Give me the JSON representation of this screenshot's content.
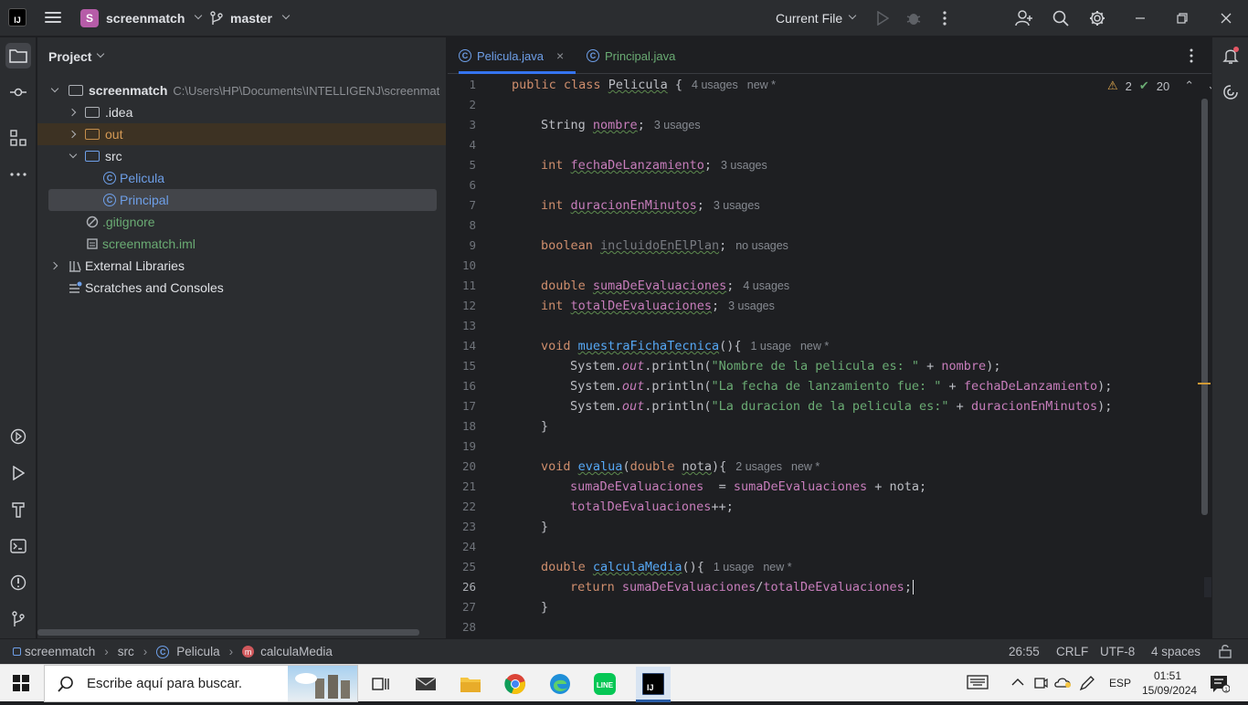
{
  "titlebar": {
    "logo_text": "IJ",
    "project_badge": "S",
    "project_name": "screenmatch",
    "branch": "master",
    "run_config": "Current File"
  },
  "project_panel": {
    "title": "Project",
    "tree": [
      {
        "label": "screenmatch",
        "path": "C:\\Users\\HP\\Documents\\INTELLIGENJ\\screenmat"
      },
      {
        "label": ".idea"
      },
      {
        "label": "out"
      },
      {
        "label": "src"
      },
      {
        "label": "Pelicula"
      },
      {
        "label": "Principal"
      },
      {
        "label": ".gitignore"
      },
      {
        "label": "screenmatch.iml"
      },
      {
        "label": "External Libraries"
      },
      {
        "label": "Scratches and Consoles"
      }
    ]
  },
  "tabs": [
    {
      "label": "Pelicula.java",
      "active": true
    },
    {
      "label": "Principal.java",
      "active": false
    }
  ],
  "inspection": {
    "warnings": "2",
    "ok": "20"
  },
  "line_numbers": [
    "1",
    "2",
    "3",
    "4",
    "5",
    "6",
    "7",
    "8",
    "9",
    "10",
    "11",
    "12",
    "13",
    "14",
    "15",
    "16",
    "17",
    "18",
    "19",
    "20",
    "21",
    "22",
    "23",
    "24",
    "25",
    "26",
    "27",
    "28"
  ],
  "code": {
    "l1": {
      "kw1": "public",
      "kw2": "class",
      "name": "Pelicula",
      "brace": "{",
      "hint": "4 usages",
      "hint2": "new *"
    },
    "l3": {
      "type": "String",
      "name": "nombre",
      "semi": ";",
      "hint": "3 usages"
    },
    "l5": {
      "type": "int",
      "name": "fechaDeLanzamiento",
      "semi": ";",
      "hint": "3 usages"
    },
    "l7": {
      "type": "int",
      "name": "duracionEnMinutos",
      "semi": ";",
      "hint": "3 usages"
    },
    "l9": {
      "type": "boolean",
      "name": "incluidoEnElPlan",
      "semi": ";",
      "hint": "no usages"
    },
    "l11": {
      "type": "double",
      "name": "sumaDeEvaluaciones",
      "semi": ";",
      "hint": "4 usages"
    },
    "l12": {
      "type": "int",
      "name": "totalDeEvaluaciones",
      "semi": ";",
      "hint": "3 usages"
    },
    "l14": {
      "type": "void",
      "name": "muestraFichaTecnica",
      "rest": "(){",
      "hint": "1 usage",
      "hint2": "new *"
    },
    "l15": {
      "a": "System.",
      "out": "out",
      "b": ".println(",
      "str": "\"Nombre de la pelicula es: \"",
      "c": " + ",
      "fld": "nombre",
      "d": ");"
    },
    "l16": {
      "a": "System.",
      "out": "out",
      "b": ".println(",
      "str": "\"La fecha de lanzamiento fue: \"",
      "c": " + ",
      "fld": "fechaDeLanzamiento",
      "d": ");"
    },
    "l17": {
      "a": "System.",
      "out": "out",
      "b": ".println(",
      "str": "\"La duracion de la pelicula es:\"",
      "c": " + ",
      "fld": "duracionEnMinutos",
      "d": ");"
    },
    "l18": {
      "brace": "}"
    },
    "l20": {
      "type": "void",
      "name": "evalua",
      "p1": "(",
      "ptype": "double",
      "pname": "nota",
      "p2": "){",
      "hint": "2 usages",
      "hint2": "new *"
    },
    "l21": {
      "f1": "sumaDeEvaluaciones",
      "op": "  = ",
      "f2": "sumaDeEvaluaciones",
      "rest": " + nota;"
    },
    "l22": {
      "f1": "totalDeEvaluaciones",
      "rest": "++;"
    },
    "l23": {
      "brace": "}"
    },
    "l25": {
      "type": "double",
      "name": "calculaMedia",
      "rest": "(){",
      "hint": "1 usage",
      "hint2": "new *"
    },
    "l26": {
      "kw": "return",
      "f1": "sumaDeEvaluaciones",
      "op": "/",
      "f2": "totalDeEvaluaciones",
      "semi": ";"
    },
    "l27": {
      "brace": "}"
    }
  },
  "statusbar": {
    "crumbs": [
      "screenmatch",
      "src",
      "Pelicula",
      "calculaMedia"
    ],
    "position": "26:55",
    "line_sep": "CRLF",
    "encoding": "UTF-8",
    "indent": "4 spaces"
  },
  "taskbar": {
    "search_placeholder": "Escribe aquí para buscar.",
    "lang": "ESP",
    "time": "01:51",
    "date": "15/09/2024"
  }
}
